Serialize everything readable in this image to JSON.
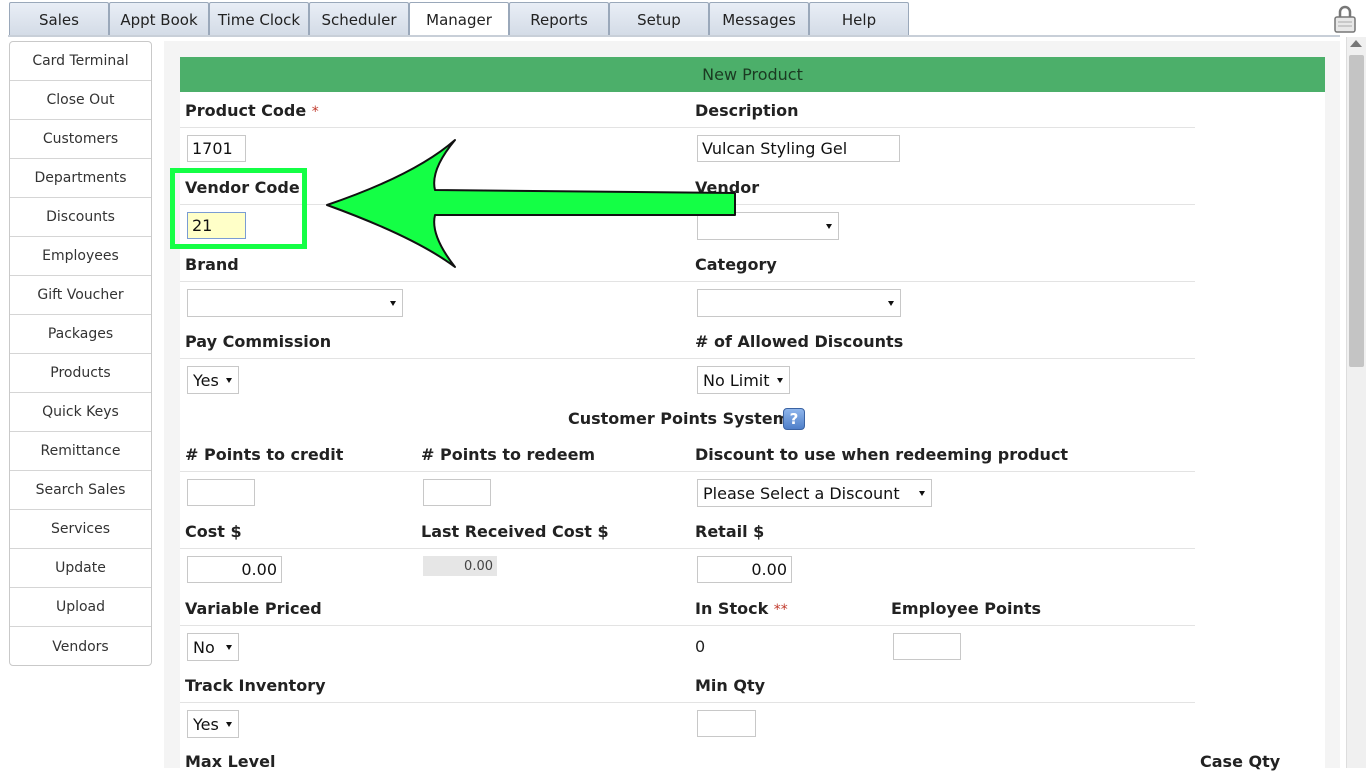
{
  "tabs": [
    {
      "label": "Sales",
      "active": false
    },
    {
      "label": "Appt Book",
      "active": false
    },
    {
      "label": "Time Clock",
      "active": false
    },
    {
      "label": "Scheduler",
      "active": false
    },
    {
      "label": "Manager",
      "active": true
    },
    {
      "label": "Reports",
      "active": false
    },
    {
      "label": "Setup",
      "active": false
    },
    {
      "label": "Messages",
      "active": false
    },
    {
      "label": "Help",
      "active": false
    }
  ],
  "sidebar": {
    "items": [
      {
        "label": "Card Terminal"
      },
      {
        "label": "Close Out"
      },
      {
        "label": "Customers"
      },
      {
        "label": "Departments"
      },
      {
        "label": "Discounts"
      },
      {
        "label": "Employees"
      },
      {
        "label": "Gift Voucher"
      },
      {
        "label": "Packages"
      },
      {
        "label": "Products"
      },
      {
        "label": "Quick Keys"
      },
      {
        "label": "Remittance"
      },
      {
        "label": "Search Sales"
      },
      {
        "label": "Services"
      },
      {
        "label": "Update"
      },
      {
        "label": "Upload"
      },
      {
        "label": "Vendors"
      }
    ]
  },
  "form": {
    "title": "New Product",
    "product_code": {
      "label": "Product Code",
      "required": "*",
      "value": "1701"
    },
    "description": {
      "label": "Description",
      "value": "Vulcan Styling Gel"
    },
    "vendor_code": {
      "label": "Vendor Code",
      "value": "21"
    },
    "vendor": {
      "label": "Vendor",
      "value": ""
    },
    "brand": {
      "label": "Brand",
      "value": ""
    },
    "category": {
      "label": "Category",
      "value": ""
    },
    "pay_commission": {
      "label": "Pay Commission",
      "value": "Yes"
    },
    "allowed_discounts": {
      "label": "# of Allowed Discounts",
      "value": "No Limit"
    },
    "points_section": {
      "title": "Customer Points System",
      "help": "?"
    },
    "points_credit": {
      "label": "# Points to credit",
      "value": ""
    },
    "points_redeem": {
      "label": "# Points to redeem",
      "value": ""
    },
    "redeem_discount": {
      "label": "Discount to use when redeeming product",
      "value": "Please Select a Discount"
    },
    "cost": {
      "label": "Cost $",
      "value": "0.00"
    },
    "last_received_cost": {
      "label": "Last Received Cost $",
      "value": "0.00"
    },
    "retail": {
      "label": "Retail $",
      "value": "0.00"
    },
    "variable_priced": {
      "label": "Variable Priced",
      "value": "No"
    },
    "in_stock": {
      "label": "In Stock",
      "required": "**",
      "value": "0"
    },
    "employee_points": {
      "label": "Employee Points",
      "value": ""
    },
    "track_inventory": {
      "label": "Track Inventory",
      "value": "Yes"
    },
    "min_qty": {
      "label": "Min Qty",
      "value": ""
    },
    "max_level": {
      "label": "Max Level"
    },
    "case_qty": {
      "label": "Case Qty"
    }
  },
  "colors": {
    "header_green": "#4caf6a",
    "highlight_green": "#14ff45",
    "required_red": "#c0392b"
  }
}
